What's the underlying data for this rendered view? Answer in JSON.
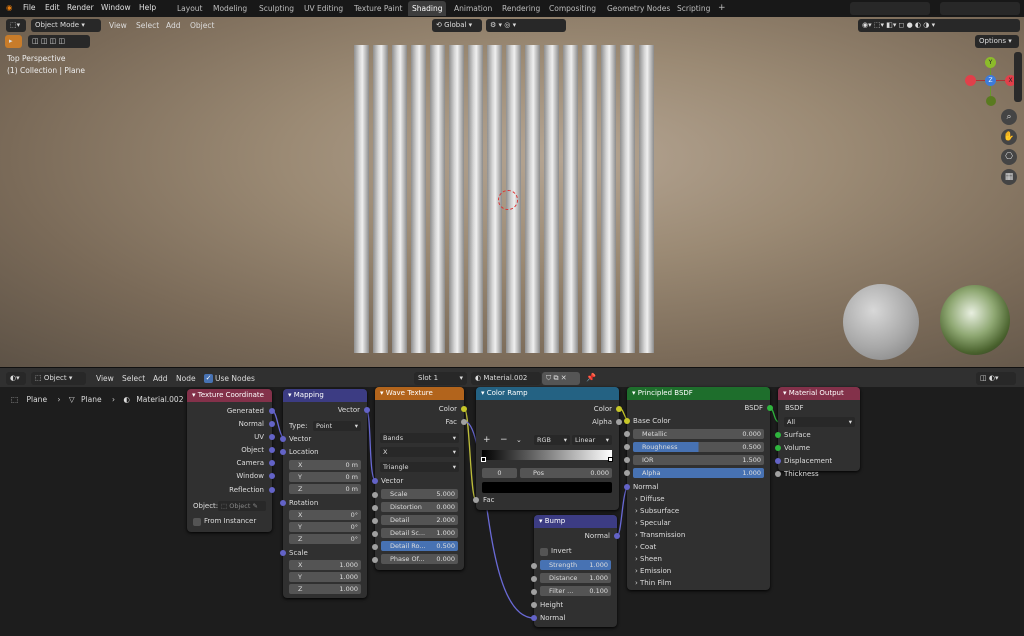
{
  "menu": {
    "file": "File",
    "edit": "Edit",
    "render": "Render",
    "window": "Window",
    "help": "Help"
  },
  "workspaces": [
    "Layout",
    "Modeling",
    "Sculpting",
    "UV Editing",
    "Texture Paint",
    "Shading",
    "Animation",
    "Rendering",
    "Compositing",
    "Geometry Nodes",
    "Scripting"
  ],
  "active_workspace": "Shading",
  "viewport": {
    "mode": "Object Mode",
    "view": "View",
    "select": "Select",
    "add": "Add",
    "object": "Object",
    "orientation": "Global",
    "info_line1": "Top Perspective",
    "info_line2": "(1) Collection | Plane",
    "options": "Options",
    "gizmo_y": "Y",
    "gizmo_x": "X",
    "gizmo_z": "Z"
  },
  "node_editor": {
    "editor_type": "Object",
    "view": "View",
    "select": "Select",
    "add": "Add",
    "node": "Node",
    "use_nodes": "Use Nodes",
    "slot": "Slot 1",
    "material": "Material.002"
  },
  "breadcrumb": {
    "obj": "Plane",
    "mesh": "Plane",
    "mat": "Material.002"
  },
  "nodes": {
    "texcoord": {
      "title": "Texture Coordinate",
      "outputs": [
        "Generated",
        "Normal",
        "UV",
        "Object",
        "Camera",
        "Window",
        "Reflection"
      ],
      "object_label": "Object:",
      "object_placeholder": "Object",
      "from_instancer": "From Instancer"
    },
    "mapping": {
      "title": "Mapping",
      "out": "Vector",
      "type_label": "Type:",
      "type_value": "Point",
      "in_vector": "Vector",
      "location": "Location",
      "rotation": "Rotation",
      "scale": "Scale",
      "loc": [
        [
          "X",
          "0 m"
        ],
        [
          "Y",
          "0 m"
        ],
        [
          "Z",
          "0 m"
        ]
      ],
      "rot": [
        [
          "X",
          "0°"
        ],
        [
          "Y",
          "0°"
        ],
        [
          "Z",
          "0°"
        ]
      ],
      "scl": [
        [
          "X",
          "1.000"
        ],
        [
          "Y",
          "1.000"
        ],
        [
          "Z",
          "1.000"
        ]
      ]
    },
    "wave": {
      "title": "Wave Texture",
      "out_color": "Color",
      "out_fac": "Fac",
      "type": "Bands",
      "dir": "X",
      "profile": "Triangle",
      "in_vector": "Vector",
      "fields": [
        [
          "Scale",
          "5.000"
        ],
        [
          "Distortion",
          "0.000"
        ],
        [
          "Detail",
          "2.000"
        ],
        [
          "Detail Sc...",
          "1.000"
        ],
        [
          "Detail Ro...",
          "0.500"
        ],
        [
          "Phase Of...",
          "0.000"
        ]
      ]
    },
    "ramp": {
      "title": "Color Ramp",
      "out_color": "Color",
      "out_alpha": "Alpha",
      "plus": "+",
      "minus": "−",
      "mode": "RGB",
      "interp": "Linear",
      "index": "0",
      "pos_label": "Pos",
      "pos_value": "0.000",
      "in_fac": "Fac"
    },
    "bump": {
      "title": "Bump",
      "out_normal": "Normal",
      "invert": "Invert",
      "fields": [
        [
          "Strength",
          "1.000"
        ],
        [
          "Distance",
          "1.000"
        ],
        [
          "Filter ...",
          "0.100"
        ]
      ],
      "in_height": "Height",
      "in_normal": "Normal"
    },
    "bsdf": {
      "title": "Principled BSDF",
      "out": "BSDF",
      "base_color": "Base Color",
      "fields": [
        [
          "Metallic",
          "0.000"
        ],
        [
          "Roughness",
          "0.500"
        ],
        [
          "IOR",
          "1.500"
        ],
        [
          "Alpha",
          "1.000"
        ]
      ],
      "normal": "Normal",
      "panels": [
        "Diffuse",
        "Subsurface",
        "Specular",
        "Transmission",
        "Coat",
        "Sheen",
        "Emission",
        "Thin Film"
      ]
    },
    "output": {
      "title": "Material Output",
      "in_bsdf": "BSDF",
      "target": "All",
      "inputs": [
        "Surface",
        "Volume",
        "Displacement",
        "Thickness"
      ]
    }
  },
  "colors": {
    "texcoord": "#83314a",
    "mapping": "#3c3c83",
    "wave": "#b2641c",
    "ramp": "#246283",
    "bump": "#3c3c83",
    "bsdf": "#1e6e2c",
    "output": "#83314a",
    "accent": "#4772b3"
  }
}
